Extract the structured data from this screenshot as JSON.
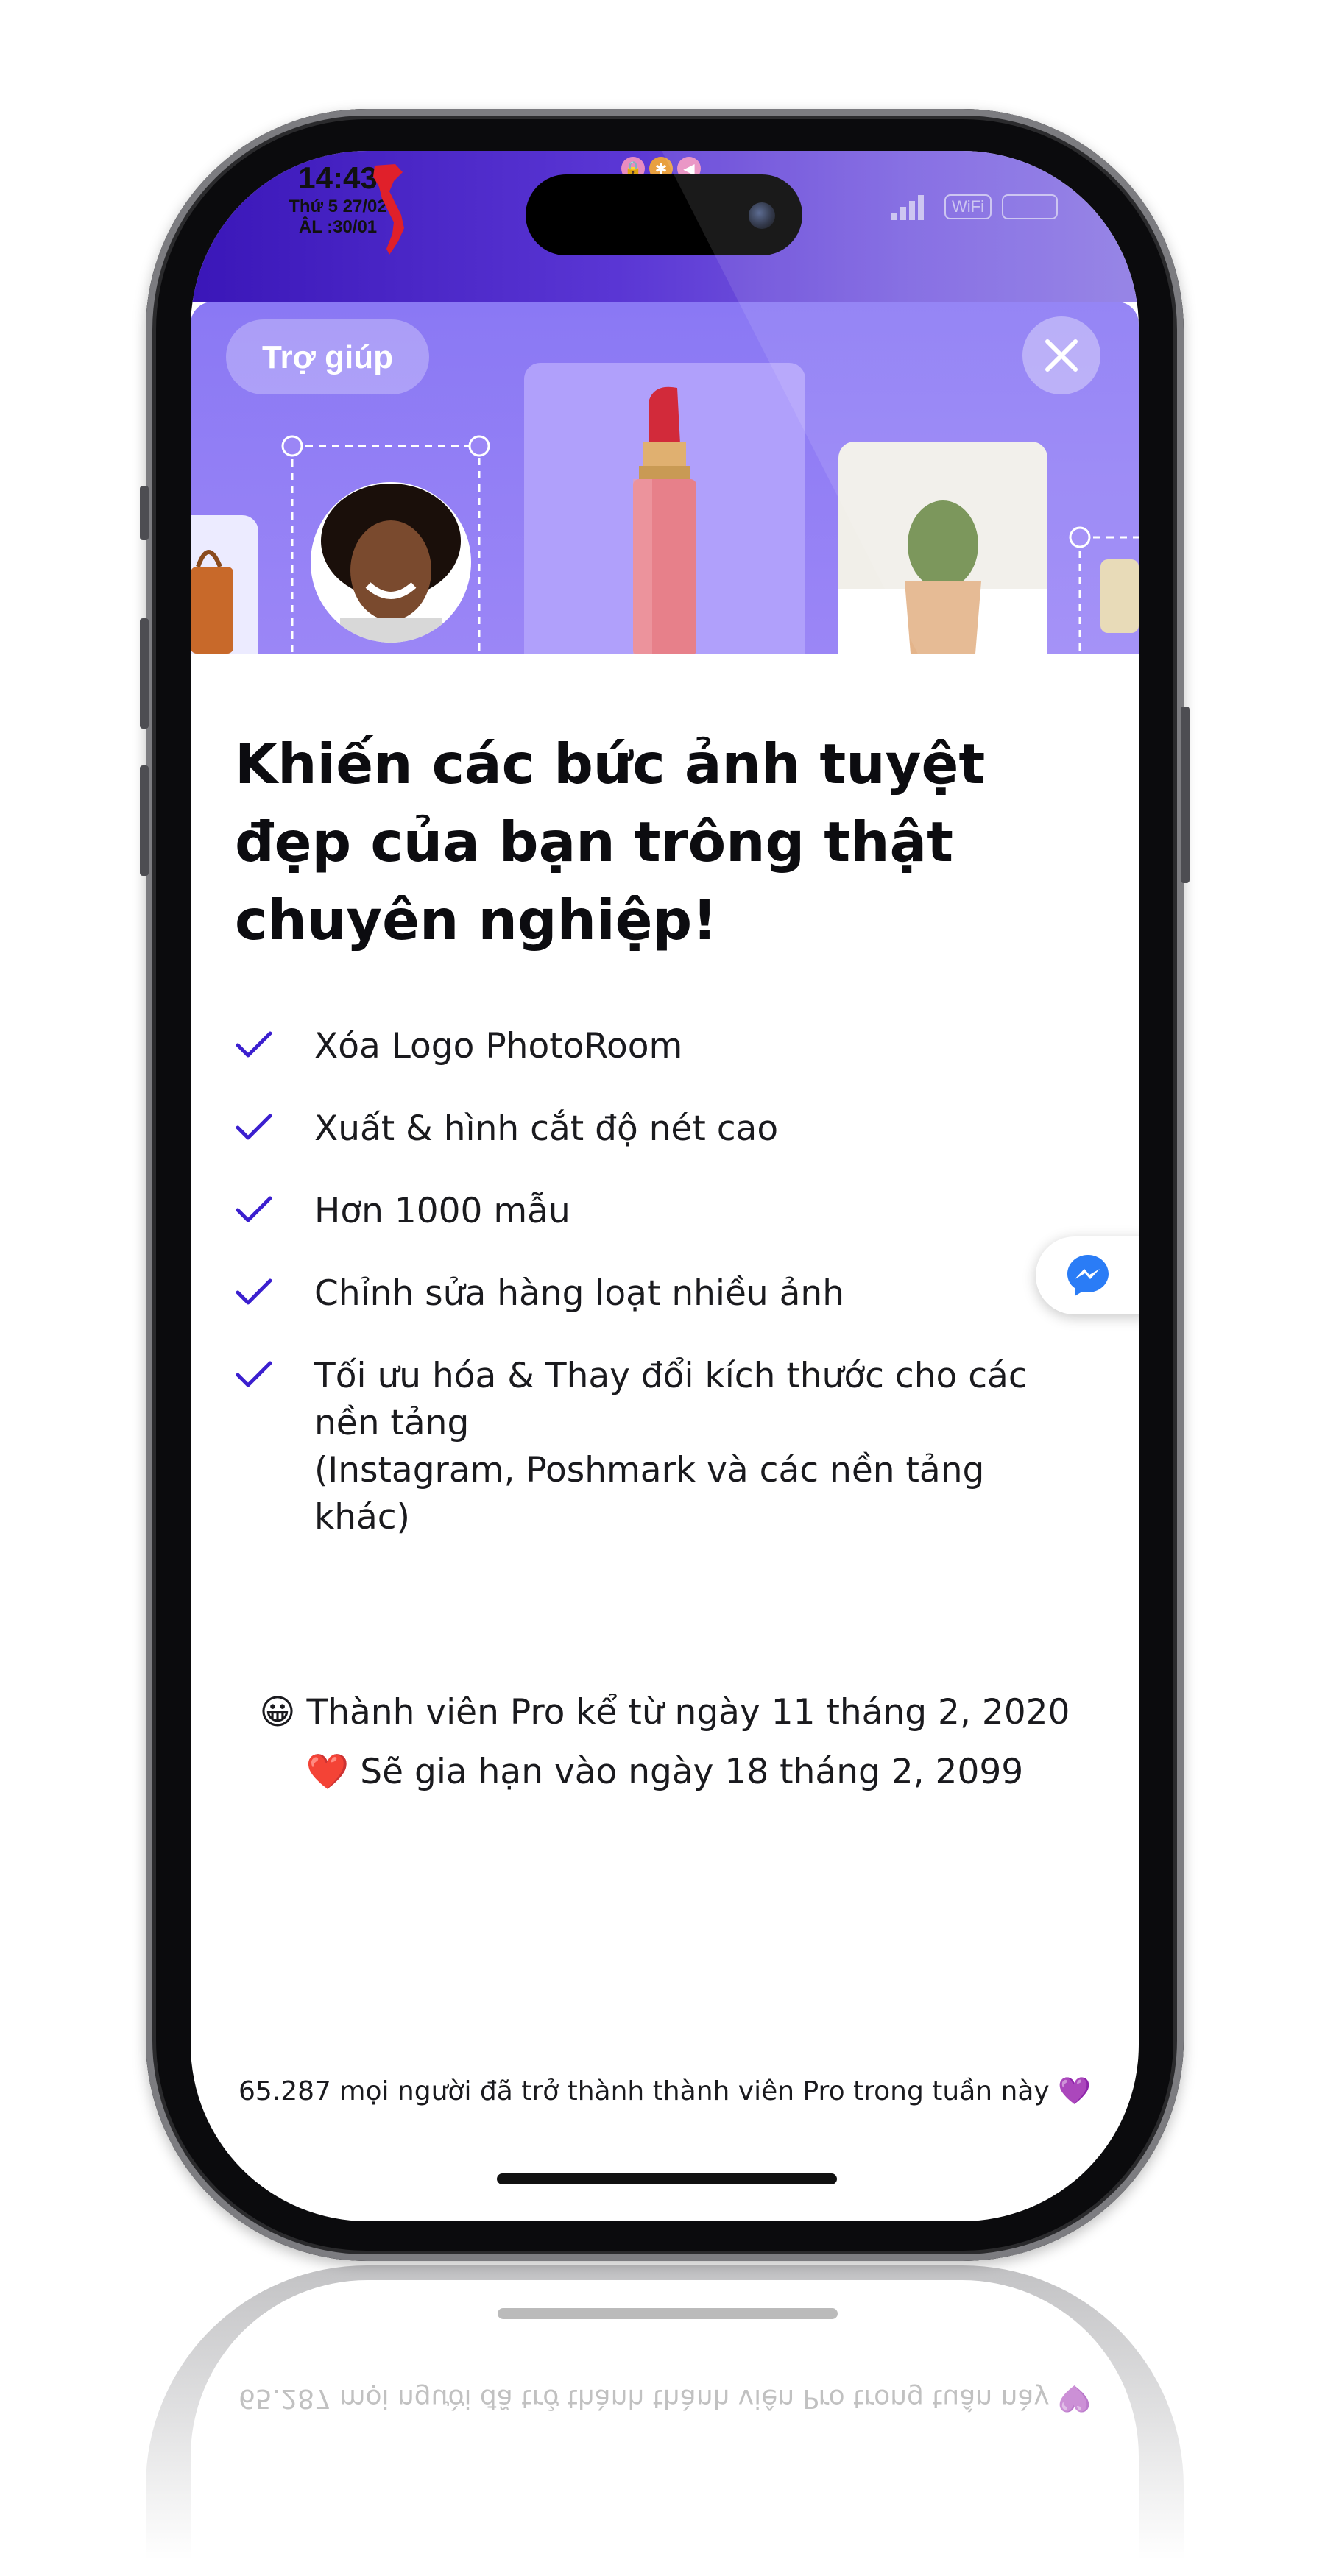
{
  "status_bar": {
    "time": "14:43",
    "date_line": "Thứ 5 27/02",
    "lunar_line": "ÂL :30/01",
    "wifi_label": "WiFi"
  },
  "hero": {
    "help_label": "Trợ giúp",
    "accent_color": "#8a78f4"
  },
  "content": {
    "title": "Khiến các bức ảnh tuyệt đẹp của bạn trông thật chuyên nghiệp!",
    "features": [
      {
        "text": "Xóa Logo PhotoRoom"
      },
      {
        "text": "Xuất & hình cắt độ nét cao"
      },
      {
        "text": "Hơn 1000 mẫu"
      },
      {
        "text": "Chỉnh sửa hàng loạt nhiều ảnh"
      },
      {
        "text": "Tối ưu hóa & Thay đổi kích thước cho các nền tảng",
        "sub": "(Instagram, Poshmark và các nền tảng khác)"
      }
    ],
    "check_color": "#3b1fcf",
    "member_since": "😀 Thành viên Pro kể từ ngày 11 tháng 2, 2020",
    "renewal": "❤️ Sẽ gia hạn vào ngày 18 tháng 2, 2099",
    "footer": "65.287 mọi người đã trở thành thành viên Pro trong tuần này 💜"
  }
}
